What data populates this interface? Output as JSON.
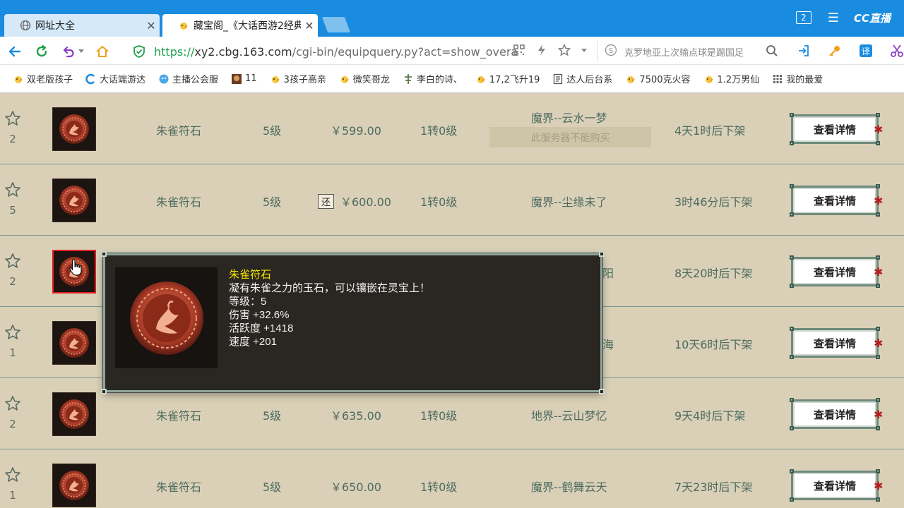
{
  "browser": {
    "tabs": [
      {
        "title": "网址大全",
        "icon": "globe-icon"
      },
      {
        "title": "藏宝阁_《大话西游2经典",
        "icon": "chick-icon"
      }
    ],
    "window_count": "2",
    "brand": "CC直播",
    "url_secure": "https://",
    "url_domain": "xy2.cbg.163.com",
    "url_path": "/cgi-bin/equipquery.py?act=show_overa",
    "search_placeholder": "克罗地亚上次输点球是踢国足",
    "bookmarks": [
      {
        "label": "双老版孩子",
        "icon": "chick-icon"
      },
      {
        "label": "大话端游达",
        "icon": "c-logo-icon"
      },
      {
        "label": "主播公会服",
        "icon": "cloud-icon"
      },
      {
        "label": "11",
        "icon": "game-avatar-icon"
      },
      {
        "label": "3孩子高亲",
        "icon": "chick-icon"
      },
      {
        "label": "微笑哥龙",
        "icon": "chick-icon"
      },
      {
        "label": "李白的诗、",
        "icon": "poem-icon"
      },
      {
        "label": "17,2飞升19",
        "icon": "chick-icon"
      },
      {
        "label": "达人后台系",
        "icon": "doc-icon"
      },
      {
        "label": "7500克火容",
        "icon": "chick-icon"
      },
      {
        "label": "1.2万男仙",
        "icon": "chick-icon"
      },
      {
        "label": "我的最爱",
        "icon": "grid-icon"
      }
    ]
  },
  "listing": {
    "detail_label": "查看详情",
    "no_buy_label": "此服务器不能购买",
    "return_badge": "还",
    "rows": [
      {
        "count": "2",
        "name": "朱雀符石",
        "level": "5级",
        "price": "￥599.00",
        "rebirth": "1转0级",
        "server": "魔界--云水一梦",
        "time": "4天1时后下架",
        "no_buy": true,
        "returnable": false
      },
      {
        "count": "5",
        "name": "朱雀符石",
        "level": "5级",
        "price": "￥600.00",
        "rebirth": "1转0级",
        "server": "魔界--尘缘未了",
        "time": "3时46分后下架",
        "no_buy": false,
        "returnable": true
      },
      {
        "count": "2",
        "name": "",
        "level": "",
        "price": "",
        "rebirth": "",
        "server": "阳",
        "time": "8天20时后下架",
        "no_buy": false,
        "returnable": false
      },
      {
        "count": "1",
        "name": "",
        "level": "",
        "price": "",
        "rebirth": "",
        "server": "海",
        "time": "10天6时后下架",
        "no_buy": false,
        "returnable": false
      },
      {
        "count": "2",
        "name": "朱雀符石",
        "level": "5级",
        "price": "￥635.00",
        "rebirth": "1转0级",
        "server": "地界--云山梦忆",
        "time": "9天4时后下架",
        "no_buy": false,
        "returnable": false
      },
      {
        "count": "1",
        "name": "朱雀符石",
        "level": "5级",
        "price": "￥650.00",
        "rebirth": "1转0级",
        "server": "魔界--鹤舞云天",
        "time": "7天23时后下架",
        "no_buy": false,
        "returnable": false
      }
    ]
  },
  "tooltip": {
    "name": "朱雀符石",
    "lines": [
      "凝有朱雀之力的玉石，可以镶嵌在灵宝上！",
      "等级：5",
      "伤害 +32.6%",
      "活跃度 +1418",
      "速度 +201"
    ]
  },
  "colors": {
    "tabbar": "#1a8ce0",
    "page_bg": "#d9d0b7",
    "row_text": "#4e6b60",
    "tooltip_bg": "#2a2722",
    "tooltip_name": "#f4e500"
  }
}
